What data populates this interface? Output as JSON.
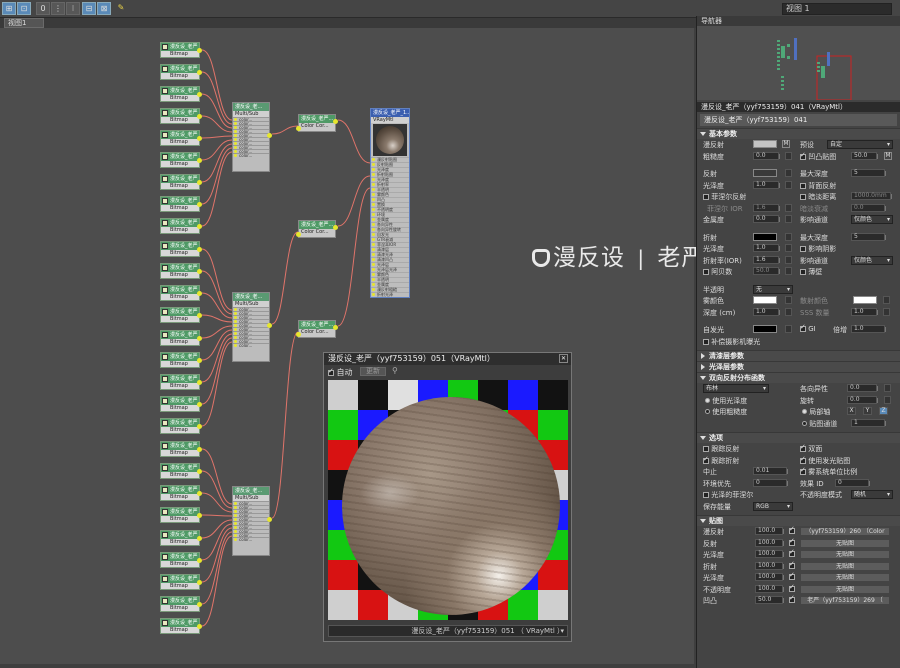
{
  "toolbar": {
    "buttons": [
      "⊞",
      "⊡",
      "0",
      "⋮",
      "⁝",
      "⊟",
      "⊠",
      "✎"
    ],
    "view_select": "视图 1"
  },
  "graph": {
    "tab_label": "视图1",
    "bitmap_title": "漫反设_老严",
    "bitmap_sub": "Bitmap",
    "multimap_title": "漫反设_老...",
    "multimap_sub": "Multi/Sub",
    "color_title": "漫反设_老严...",
    "color_sub": "Color Cor...",
    "color_sub_out": "贴图",
    "slot_label": "color...",
    "vray_title": "漫反设_老严_1...",
    "vray_sub": "VRayMtl",
    "vray_slots": [
      "漫反射贴图",
      "反射贴图",
      "光泽度",
      "折射贴图",
      "光泽度",
      "折射率",
      "半透明",
      "雾颜色",
      "凹凸",
      "置换",
      "不透明度",
      "环境",
      "金属度",
      "各向异性",
      "各向异性旋转",
      "自发光",
      "GTR衰减",
      "菲涅耳IOR",
      "清漆层",
      "清漆光泽",
      "清漆凹凸",
      "光泽层",
      "光泽层光泽",
      "雾颜色",
      "半透明",
      "金属度",
      "漫反射粗糙",
      "折射光泽"
    ]
  },
  "watermark": {
    "brand": "漫反设",
    "sep": "|",
    "author": "老严"
  },
  "preview": {
    "title": "漫反设_老严（yyf753159）051（VRayMtl）",
    "auto_label": "自动",
    "update_label": "更新",
    "material_select": "漫反设_老严（yyf753159）051 （ VRayMtl ）"
  },
  "panel": {
    "navigator": "导航器",
    "title": "漫反设_老严（yyf753159）041（VRayMtl）",
    "material_name": "漫反设_老严（yyf753159）041",
    "basic_header": "基本参数",
    "diffuse_label": "漫反射",
    "m_label": "M",
    "preset_label": "预设",
    "preset_value": "自定",
    "roughness_label": "粗糙度",
    "roughness_value": "0.0",
    "bump_map_label": "凹凸贴图",
    "bump_map_value": "50.0",
    "reflect_label": "反射",
    "max_depth_label": "最大深度",
    "max_depth_value": "5",
    "gloss_label": "光泽度",
    "gloss_value": "1.0",
    "back_reflect_label": "背面反射",
    "fresnel_label": "菲涅尔反射",
    "dim_dist_label": "暗淡距离",
    "dim_dist_value": "1000.0mm",
    "fresnel_ior_label": "菲涅尔 IOR",
    "fresnel_ior_value": "1.6",
    "dim_falloff_label": "暗淡衰减",
    "dim_falloff_value": "0.0",
    "metal_label": "金属度",
    "metal_value": "0.0",
    "affect_channel_label": "影响通道",
    "affect_channel_value": "仅颜色",
    "refract_label": "折射",
    "refr_depth_label": "最大深度",
    "refr_depth_value": "5",
    "refr_gloss_label": "光泽度",
    "refr_gloss_value": "1.0",
    "affect_shadow_label": "影响阴影",
    "ior_label": "折射率(IOR)",
    "ior_value": "1.6",
    "refr_affect_label": "影响通道",
    "refr_affect_value": "仅颜色",
    "abbe_label": "阿贝数",
    "abbe_value": "50.0",
    "thin_label": "薄壁",
    "translucency_label": "半透明",
    "translucency_value": "无",
    "fog_color_label": "雾颜色",
    "scatter_color_label": "散射颜色",
    "depth_label": "深度 (cm)",
    "depth_value": "1.0",
    "sss_label": "SSS 数量",
    "sss_value": "1.0",
    "self_illum_label": "自发光",
    "gi_label": "GI",
    "multiplier_label": "倍增",
    "multiplier_value": "1.0",
    "comp_camera_label": "补偿摄影机曝光",
    "coat_header": "清漆层参数",
    "sheen_header": "光泽层参数",
    "brdf_header": "双向反射分布函数",
    "brdf_value": "布林",
    "anisotropy_label": "各向异性",
    "anisotropy_value": "0.0",
    "use_gloss_label": "使用光泽度",
    "rotation_label": "旋转",
    "rotation_value": "0.0",
    "use_rough_label": "使用粗糙度",
    "local_axis_label": "局部轴",
    "axis_x": "X",
    "axis_y": "Y",
    "axis_z": "Z",
    "map_channel_label": "贴图通道",
    "map_channel_value": "1",
    "options_header": "选项",
    "trace_reflect_label": "跟踪反射",
    "double_sided_label": "双面",
    "trace_refract_label": "跟踪折射",
    "use_illum_map_label": "使用发光贴图",
    "cutoff_label": "中止",
    "cutoff_value": "0.01",
    "unit_scale_label": "雾系统单位比例",
    "env_priority_label": "环境优先",
    "env_priority_value": "0",
    "effect_id_label": "效果 ID",
    "effect_id_value": "0",
    "gloss_fresnel_label": "光泽的菲涅尔",
    "opacity_mode_label": "不透明度模式",
    "opacity_mode_value": "随机",
    "energy_label": "保存能量",
    "energy_value": "RGB",
    "maps_header": "贴图",
    "maps": [
      {
        "label": "漫反射",
        "value": "100.0",
        "map": "（yyf753159）260 （Color"
      },
      {
        "label": "反射",
        "value": "100.0",
        "map": "无贴图"
      },
      {
        "label": "光泽度",
        "value": "100.0",
        "map": "无贴图"
      },
      {
        "label": "折射",
        "value": "100.0",
        "map": "无贴图"
      },
      {
        "label": "光泽度",
        "value": "100.0",
        "map": "无贴图"
      },
      {
        "label": "不透明度",
        "value": "100.0",
        "map": "无贴图"
      },
      {
        "label": "凹凸",
        "value": "50.0",
        "map": "老严（yyf753159）269 （"
      }
    ]
  },
  "colors": {
    "diffuse": "#c4c4c4",
    "reflect": "#3a3a3a",
    "refract": "#000000",
    "fog": "#ffffff",
    "scatter": "#ffffff",
    "self_illum": "#000000",
    "wire": "#e0746a",
    "port": "#e6e62e"
  }
}
